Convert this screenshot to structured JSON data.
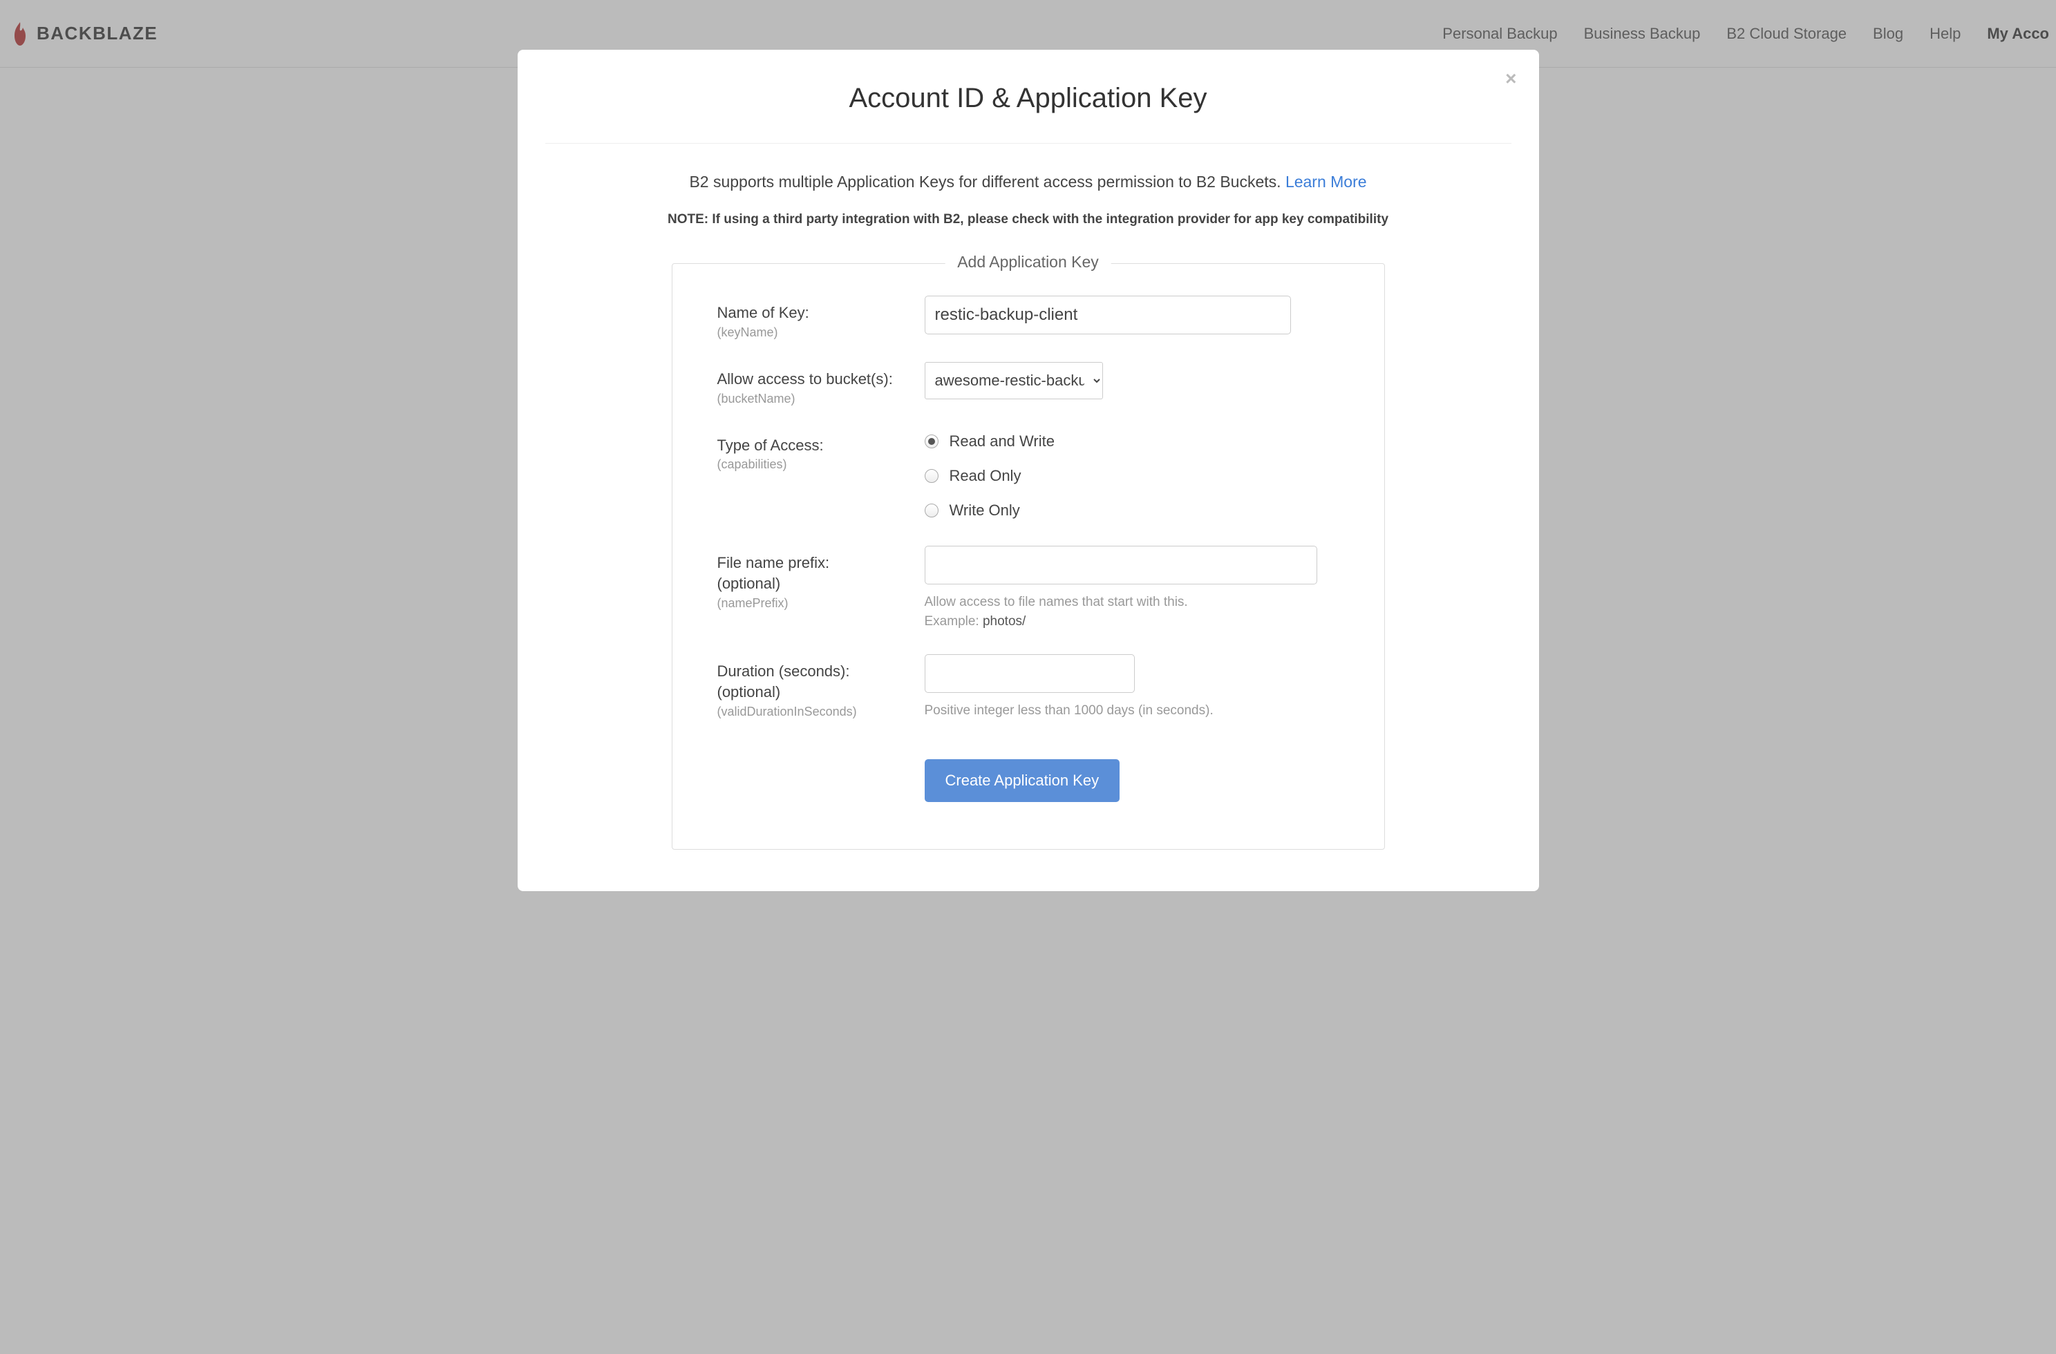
{
  "brand": "BACKBLAZE",
  "nav": {
    "personal_backup": "Personal Backup",
    "business_backup": "Business Backup",
    "b2_cloud": "B2 Cloud Storage",
    "blog": "Blog",
    "help": "Help",
    "my_account": "My Acco"
  },
  "modal": {
    "title": "Account ID & Application Key",
    "intro_text": "B2 supports multiple Application Keys for different access permission to B2 Buckets. ",
    "learn_more": "Learn More",
    "note": "NOTE: If using a third party integration with B2, please check with the integration provider for app key compatibility",
    "legend": "Add Application Key",
    "fields": {
      "key_name": {
        "label": "Name of Key:",
        "sublabel": "(keyName)",
        "value": "restic-backup-client"
      },
      "bucket": {
        "label": "Allow access to bucket(s):",
        "sublabel": "(bucketName)",
        "selected": "awesome-restic-backup"
      },
      "access_type": {
        "label": "Type of Access:",
        "sublabel": "(capabilities)",
        "options": {
          "rw": "Read and Write",
          "ro": "Read Only",
          "wo": "Write Only"
        }
      },
      "prefix": {
        "label1": "File name prefix:",
        "label2": "(optional)",
        "sublabel": "(namePrefix)",
        "help": "Allow access to file names that start with this.",
        "example_label": "Example: ",
        "example_value": "photos/"
      },
      "duration": {
        "label1": "Duration (seconds):",
        "label2": "(optional)",
        "sublabel": "(validDurationInSeconds)",
        "help": "Positive integer less than 1000 days (in seconds)."
      }
    },
    "submit": "Create Application Key"
  }
}
